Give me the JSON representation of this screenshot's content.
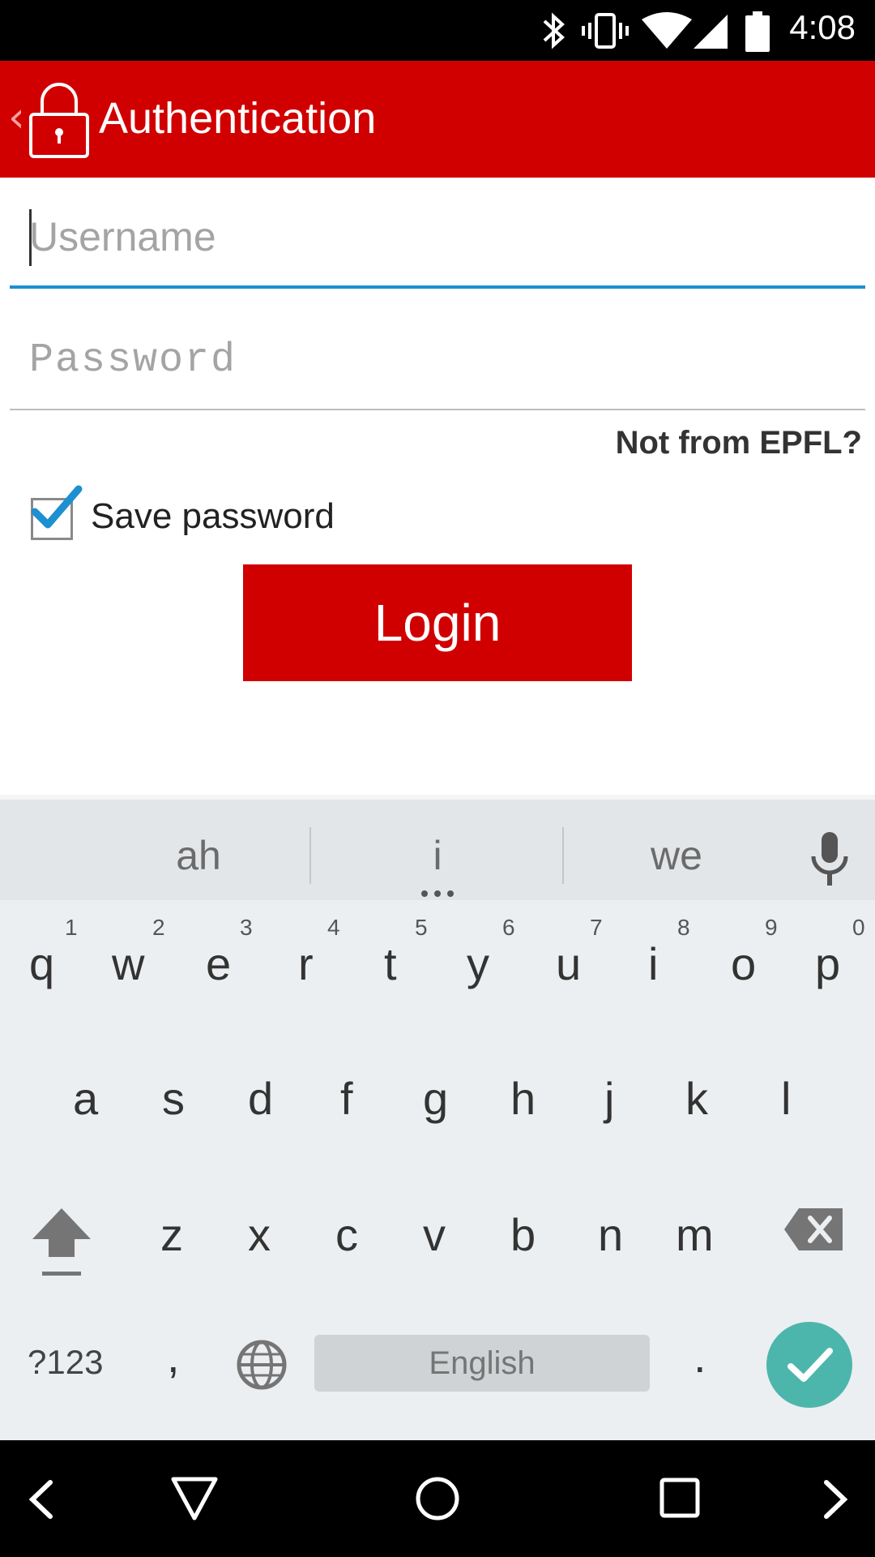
{
  "status_bar": {
    "time": "4:08"
  },
  "action_bar": {
    "title": "Authentication"
  },
  "form": {
    "username_placeholder": "Username",
    "password_placeholder": "Password",
    "not_from_epfl": "Not from EPFL?",
    "save_password_label": "Save password",
    "save_password_checked": true,
    "login_label": "Login"
  },
  "keyboard": {
    "suggestions": [
      "ah",
      "i",
      "we"
    ],
    "row1": [
      "q",
      "w",
      "e",
      "r",
      "t",
      "y",
      "u",
      "i",
      "o",
      "p"
    ],
    "row1_hints": [
      "1",
      "2",
      "3",
      "4",
      "5",
      "6",
      "7",
      "8",
      "9",
      "0"
    ],
    "row2": [
      "a",
      "s",
      "d",
      "f",
      "g",
      "h",
      "j",
      "k",
      "l"
    ],
    "row3": [
      "z",
      "x",
      "c",
      "v",
      "b",
      "n",
      "m"
    ],
    "symbols_label": "?123",
    "comma": ",",
    "space_label": "English",
    "period": ".",
    "accent_color": "#4db6ac"
  },
  "colors": {
    "brand_red": "#d10000",
    "focus_blue": "#1e8fd0"
  }
}
